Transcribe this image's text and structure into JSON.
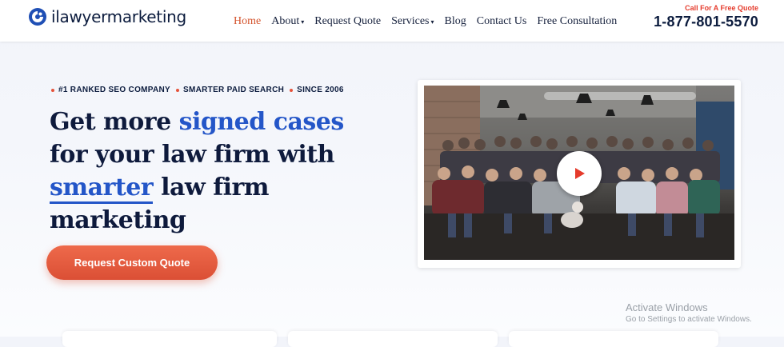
{
  "brand": {
    "name": "ilawyermarketing",
    "icon": "logo-swirl-icon",
    "color": "#1f4fb5"
  },
  "nav": {
    "items": [
      {
        "label": "Home",
        "active": true,
        "dropdown": false
      },
      {
        "label": "About",
        "active": false,
        "dropdown": true
      },
      {
        "label": "Request Quote",
        "active": false,
        "dropdown": false
      },
      {
        "label": "Services",
        "active": false,
        "dropdown": true
      },
      {
        "label": "Blog",
        "active": false,
        "dropdown": false
      },
      {
        "label": "Contact Us",
        "active": false,
        "dropdown": false
      },
      {
        "label": "Free Consultation",
        "active": false,
        "dropdown": false
      }
    ],
    "caret": "▾"
  },
  "cta": {
    "label": "Call For A Free Quote",
    "phone": "1-877-801-5570"
  },
  "hero": {
    "badges": [
      "#1 RANKED SEO COMPANY",
      "SMARTER PAID SEARCH",
      "SINCE 2006"
    ],
    "headline": {
      "part1": "Get more ",
      "highlight1": "signed cases",
      "part2": " for your law firm with ",
      "highlight2": "smarter",
      "part3": " law firm marketing"
    },
    "button": "Request Custom Quote"
  },
  "video": {
    "play_icon": "play-icon"
  },
  "watermark": {
    "title": "Activate Windows",
    "subtitle": "Go to Settings to activate Windows."
  },
  "colors": {
    "accent": "#e5533b",
    "navy": "#0e1a3c",
    "blue": "#2456c8",
    "active_nav": "#d4532c"
  }
}
